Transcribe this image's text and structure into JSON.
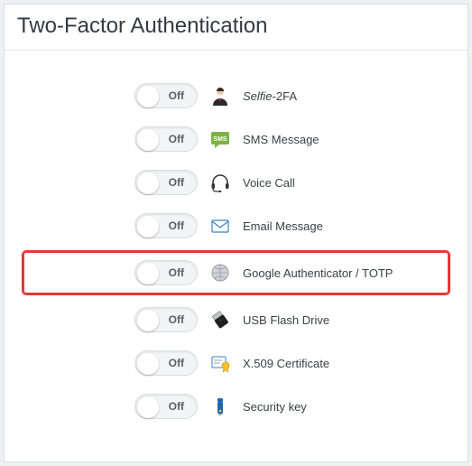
{
  "header": {
    "title": "Two-Factor Authentication"
  },
  "toggle_state_label": "Off",
  "methods": [
    {
      "id": "selfie",
      "icon": "selfie-icon",
      "label_html": "<em>Selfie</em>-2FA",
      "highlighted": false
    },
    {
      "id": "sms",
      "icon": "sms-icon",
      "label_html": "SMS Message",
      "highlighted": false
    },
    {
      "id": "voice",
      "icon": "voice-icon",
      "label_html": "Voice Call",
      "highlighted": false
    },
    {
      "id": "email",
      "icon": "email-icon",
      "label_html": "Email Message",
      "highlighted": false
    },
    {
      "id": "totp",
      "icon": "totp-icon",
      "label_html": "Google Authenticator / TOTP",
      "highlighted": true
    },
    {
      "id": "usb",
      "icon": "usb-icon",
      "label_html": "USB Flash Drive",
      "highlighted": false
    },
    {
      "id": "x509",
      "icon": "cert-icon",
      "label_html": "X.509 Certificate",
      "highlighted": false
    },
    {
      "id": "key",
      "icon": "key-icon",
      "label_html": "Security key",
      "highlighted": false
    }
  ]
}
